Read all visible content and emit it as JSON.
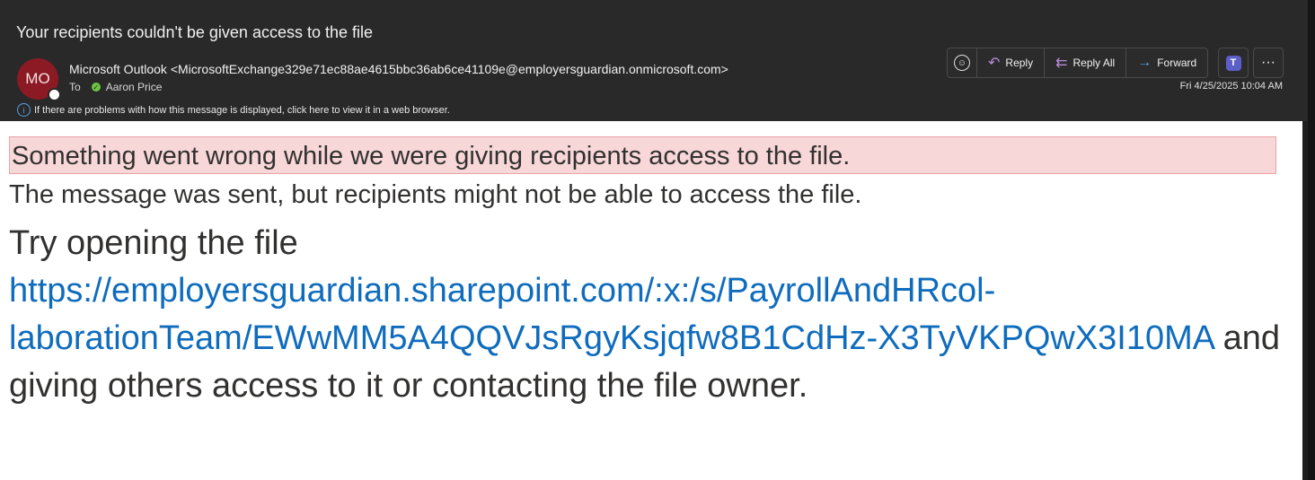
{
  "header": {
    "subject": "Your recipients couldn't be given access to the file",
    "avatar_initials": "MO",
    "from": "Microsoft Outlook <MicrosoftExchange329e71ec88ae4615bbc36ab6ce41109e@employersguardian.onmicrosoft.com>",
    "to_label": "To",
    "to_name": "Aaron Price",
    "info_text": "If there are problems with how this message is displayed, click here to view it in a web browser.",
    "date": "Fri 4/25/2025 10:04 AM"
  },
  "actions": {
    "reply": "Reply",
    "reply_all": "Reply All",
    "forward": "Forward"
  },
  "body": {
    "error_banner": "Something went wrong while we were giving recipients access to the file.",
    "sent_text": "The message was sent, but recipients might not be able to access the file.",
    "try_prefix": "Try opening the file ",
    "link": "https://employersguardian.sharepoint.com/:x:/s/PayrollAndHRcol­laborationTeam/EWwMM5A4QQVJsRgyKsjqfw8B1CdHz-X3TyVKPQwX3I10MA",
    "try_suffix": " and giving others access to it or contacting the file owner."
  },
  "colors": {
    "avatar": "#8b1a24",
    "link": "#0f6cbd",
    "banner_bg": "#f8d7d8"
  }
}
